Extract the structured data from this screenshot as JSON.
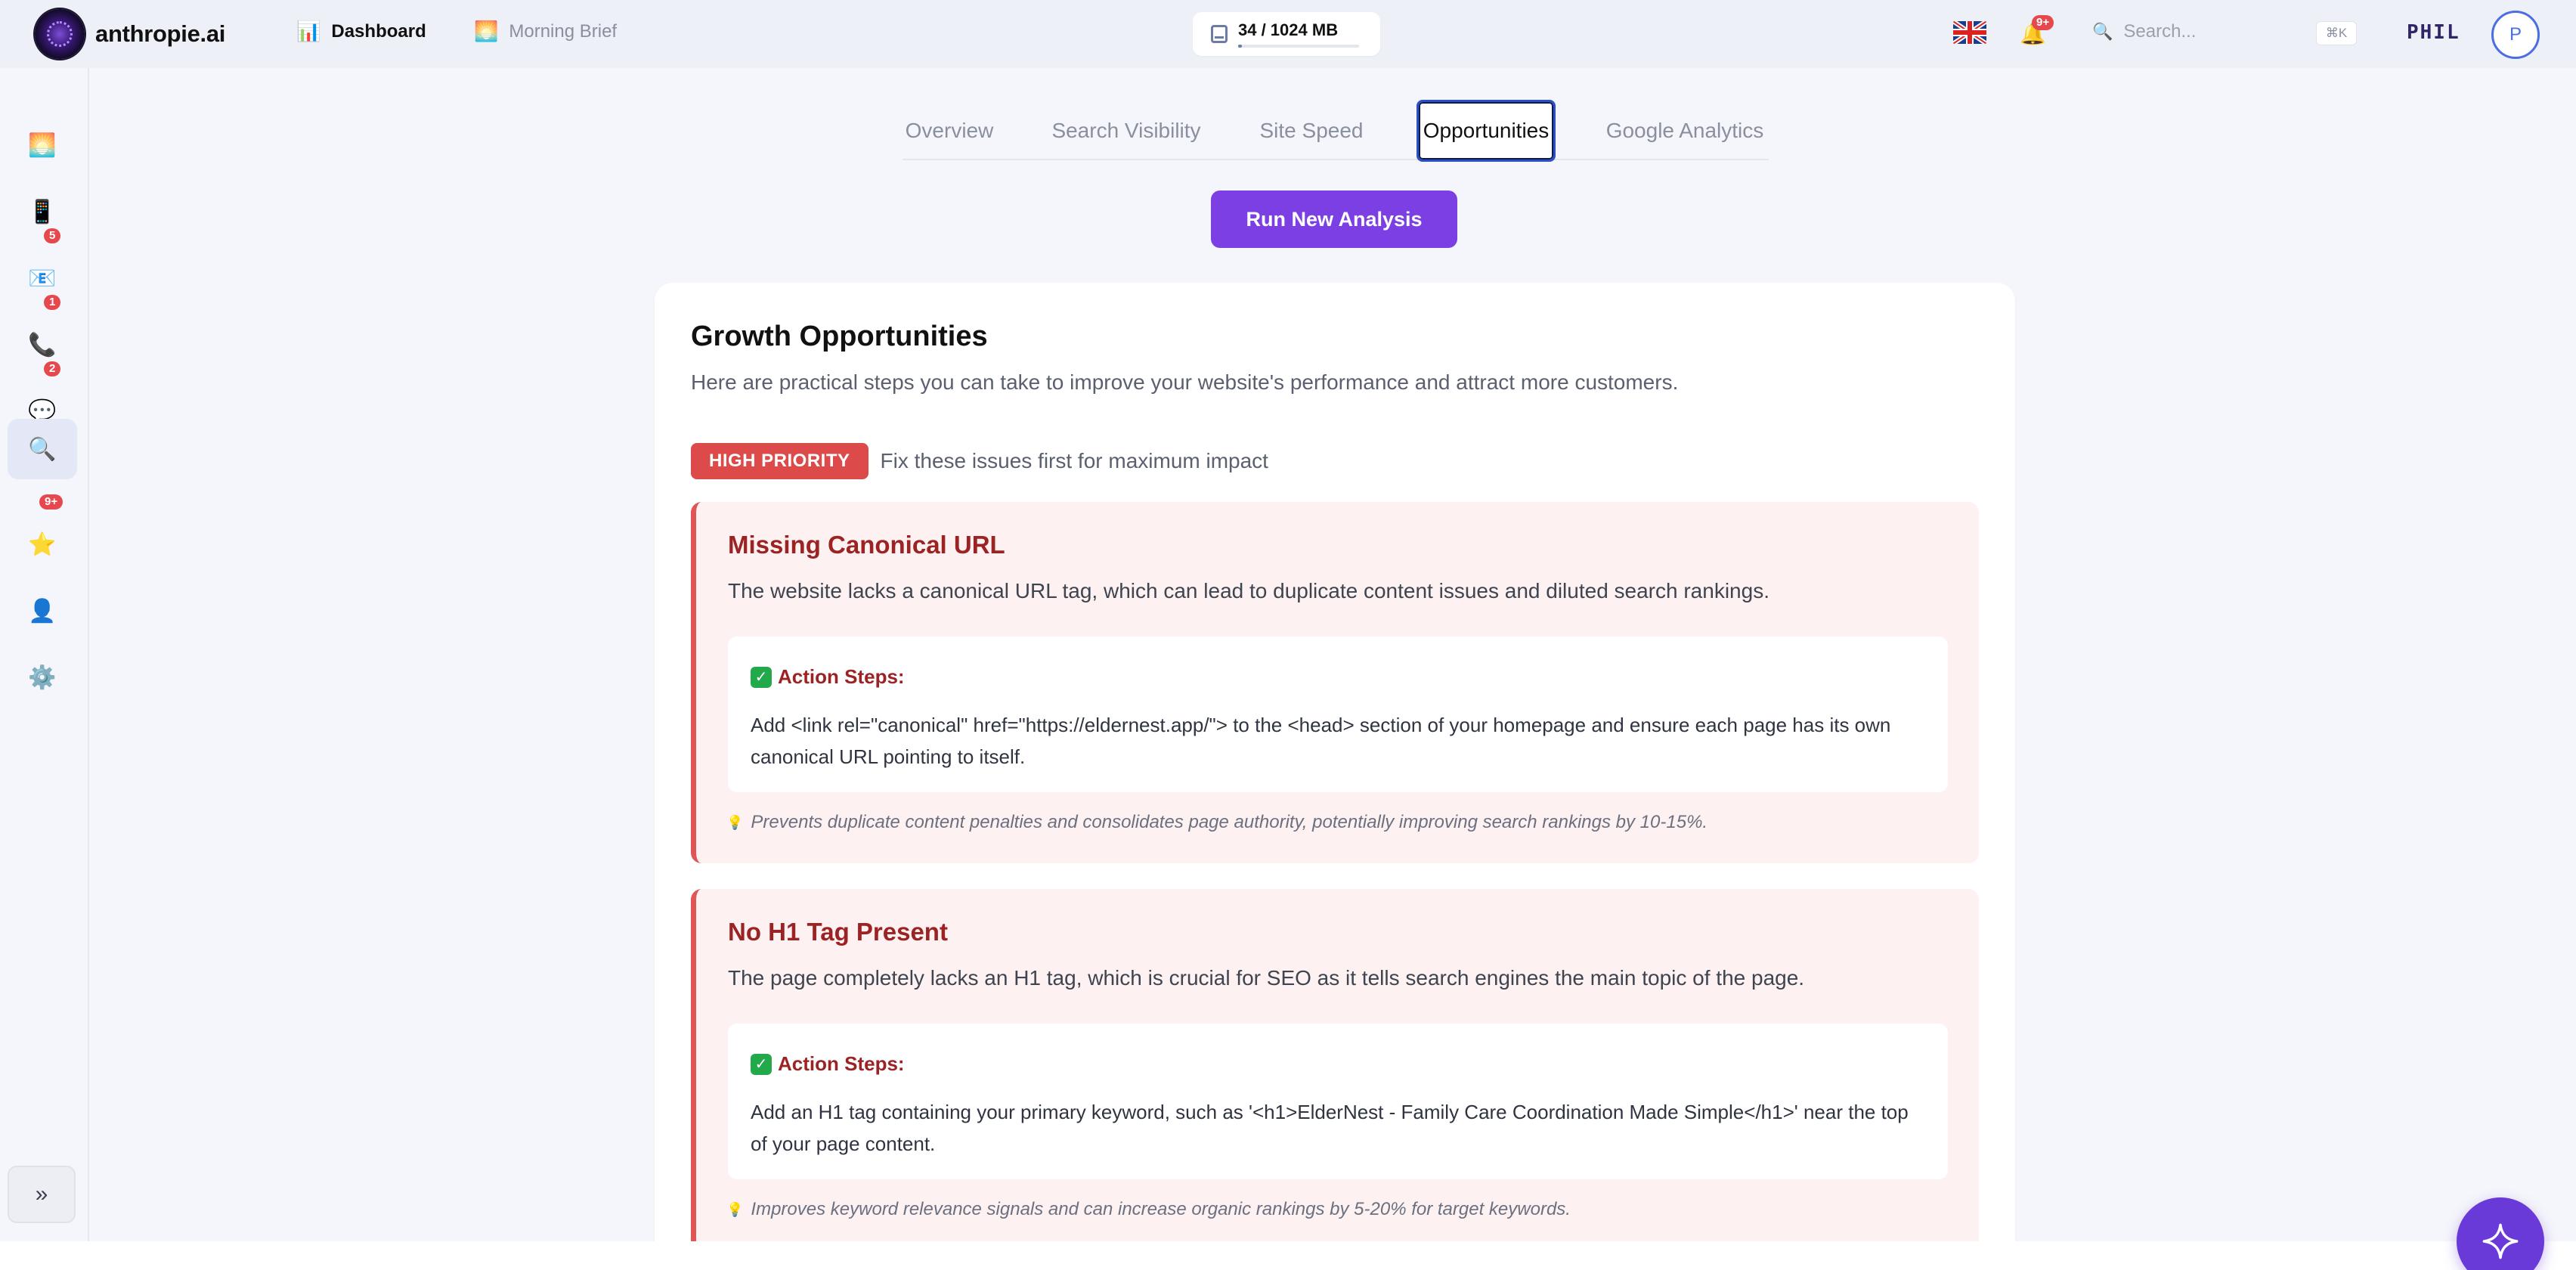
{
  "header": {
    "brand": "anthropie.ai",
    "nav": [
      {
        "label": "Dashboard",
        "icon": "bar-chart-icon"
      },
      {
        "label": "Morning Brief",
        "icon": "sunrise-icon"
      }
    ],
    "storage": {
      "text": "34 / 1024 MB",
      "used_fraction": 0.033
    },
    "notifications_badge": "9+",
    "search": {
      "placeholder": "Search...",
      "shortcut": "⌘K"
    },
    "user": {
      "name": "PHIL",
      "initial": "P"
    }
  },
  "sidebar": {
    "items": [
      {
        "icon": "sunrise-icon",
        "badge": ""
      },
      {
        "icon": "phone-device-icon",
        "badge": ""
      },
      {
        "icon": "mail-icon",
        "badge": "5"
      },
      {
        "icon": "phone-call-icon",
        "badge": "1"
      },
      {
        "icon": "chat-icon",
        "badge": "2"
      },
      {
        "icon": "search-icon",
        "badge": "",
        "active": true
      },
      {
        "icon": "star-icon",
        "badge": "9+"
      },
      {
        "icon": "user-icon",
        "badge": ""
      },
      {
        "icon": "gear-icon",
        "badge": ""
      }
    ],
    "collapse_label": "»"
  },
  "tabs": [
    {
      "label": "Overview"
    },
    {
      "label": "Search Visibility"
    },
    {
      "label": "Site Speed"
    },
    {
      "label": "Opportunities",
      "active": true
    },
    {
      "label": "Google Analytics"
    }
  ],
  "run_button_label": "Run New Analysis",
  "panel": {
    "title": "Growth Opportunities",
    "subtitle": "Here are practical steps you can take to improve your website's performance and attract more customers.",
    "priority_badge": "HIGH PRIORITY",
    "priority_text": "Fix these issues first for maximum impact",
    "cards": [
      {
        "title": "Missing Canonical URL",
        "description": "The website lacks a canonical URL tag, which can lead to duplicate content issues and diluted search rankings.",
        "action_label": "Action Steps:",
        "action_text": "Add <link rel=\"canonical\" href=\"https://eldernest.app/\"> to the <head> section of your homepage and ensure each page has its own canonical URL pointing to itself.",
        "impact": "Prevents duplicate content penalties and consolidates page authority, potentially improving search rankings by 10-15%."
      },
      {
        "title": "No H1 Tag Present",
        "description": "The page completely lacks an H1 tag, which is crucial for SEO as it tells search engines the main topic of the page.",
        "action_label": "Action Steps:",
        "action_text": "Add an H1 tag containing your primary keyword, such as '<h1>ElderNest - Family Care Coordination Made Simple</h1>' near the top of your page content.",
        "impact": "Improves keyword relevance signals and can increase organic rankings by 5-20% for target keywords."
      }
    ]
  },
  "colors": {
    "accent": "#7b3fe4",
    "priority_red": "#dc4a4a",
    "card_bg": "#fdf1f1",
    "title_red": "#9b2323"
  }
}
